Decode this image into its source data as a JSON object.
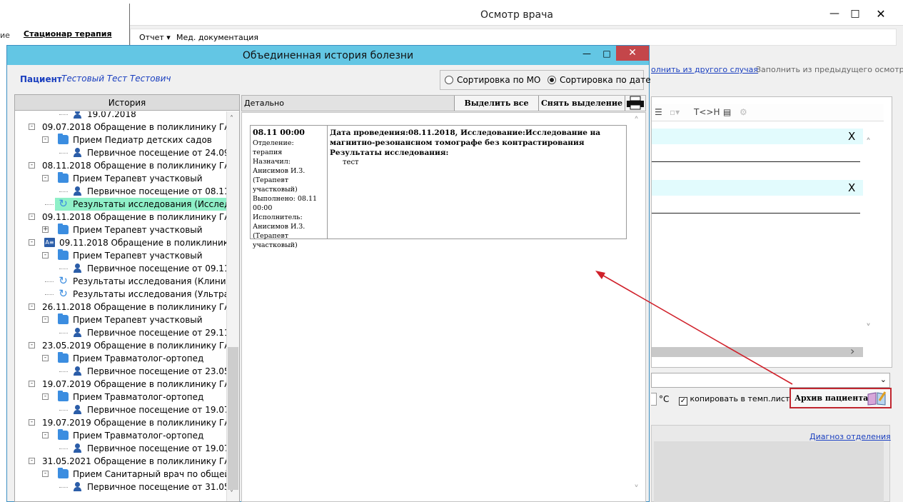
{
  "background": {
    "tab_label": "Стационар терапия",
    "left_fragment": "ие"
  },
  "exam_window": {
    "title": "Осмотр врача",
    "menu": [
      "Отчет",
      "Мед. документация"
    ],
    "links": {
      "fill_other_case": "олнить из другого случая",
      "fill_previous": "Заполнить из предыдущего осмотра",
      "diagnosis_dept": "Диагноз отделения"
    },
    "toolbar_tokens": "T<>H",
    "row_close_mark": "X",
    "temp_unit": "°C",
    "copy_to_temp_sheet_label": "копировать в темп.лист",
    "copy_to_temp_sheet_checked": true,
    "archive_button": "Архив пациента"
  },
  "history_window": {
    "title": "Объединенная история болезни",
    "patient_label": "Пациент",
    "patient_name": "Тестовый Тест Тестович",
    "sort_options": [
      {
        "label": "Сортировка по МО",
        "selected": false
      },
      {
        "label": "Сортировка по дате",
        "selected": true
      }
    ],
    "tree_header": "История",
    "tree_rows": [
      {
        "level": 3,
        "icon": "person-icon",
        "text": "19.07.2018"
      },
      {
        "level": 1,
        "icon": "",
        "text": "09.07.2018  Обращение в поликлинику ГАУЗ",
        "expander": "-"
      },
      {
        "level": 2,
        "icon": "folder-icon",
        "text": "Прием Педиатр детских садов",
        "expander": "-"
      },
      {
        "level": 3,
        "icon": "person-icon",
        "text": "Первичное посещение от 24.09.2"
      },
      {
        "level": 1,
        "icon": "",
        "text": "08.11.2018  Обращение в поликлинику ГАУЗ",
        "expander": "-"
      },
      {
        "level": 2,
        "icon": "folder-icon",
        "text": "Прием Терапевт участковый",
        "expander": "-"
      },
      {
        "level": 3,
        "icon": "person-icon",
        "text": "Первичное посещение от 08.11.2"
      },
      {
        "level": 2,
        "icon": "refresh-icon",
        "text": "Результаты исследования (Исследо",
        "selected": true
      },
      {
        "level": 1,
        "icon": "",
        "text": "09.11.2018  Обращение в поликлинику ГАУЗ",
        "expander": "-"
      },
      {
        "level": 2,
        "icon": "folder-icon",
        "text": "Прием Терапевт участковый",
        "expander": "+"
      },
      {
        "level": 1,
        "icon": "card-icon",
        "text": "09.11.2018  Обращение в поликлинику П",
        "expander": "-"
      },
      {
        "level": 2,
        "icon": "folder-icon",
        "text": "Прием Терапевт участковый",
        "expander": "-"
      },
      {
        "level": 3,
        "icon": "person-icon",
        "text": "Первичное посещение от 09.11.2"
      },
      {
        "level": 2,
        "icon": "refresh-icon",
        "text": "Результаты исследования (Клиниче"
      },
      {
        "level": 2,
        "icon": "refresh-icon",
        "text": "Результаты исследования (Ультраз"
      },
      {
        "level": 1,
        "icon": "",
        "text": "26.11.2018  Обращение в поликлинику ГАУЗ",
        "expander": "-"
      },
      {
        "level": 2,
        "icon": "folder-icon",
        "text": "Прием Терапевт участковый",
        "expander": "-"
      },
      {
        "level": 3,
        "icon": "person-icon",
        "text": "Первичное посещение от 29.11.2"
      },
      {
        "level": 1,
        "icon": "",
        "text": "23.05.2019  Обращение в поликлинику ГАУЗ",
        "expander": "-"
      },
      {
        "level": 2,
        "icon": "folder-icon",
        "text": "Прием Травматолог-ортопед",
        "expander": "-"
      },
      {
        "level": 3,
        "icon": "person-icon",
        "text": "Первичное посещение от 23.05.2"
      },
      {
        "level": 1,
        "icon": "",
        "text": "19.07.2019  Обращение в поликлинику ГАУЗ",
        "expander": "-"
      },
      {
        "level": 2,
        "icon": "folder-icon",
        "text": "Прием Травматолог-ортопед",
        "expander": "-"
      },
      {
        "level": 3,
        "icon": "person-icon",
        "text": "Первичное посещение от 19.07.2"
      },
      {
        "level": 1,
        "icon": "",
        "text": "19.07.2019  Обращение в поликлинику ГАУЗ",
        "expander": "-"
      },
      {
        "level": 2,
        "icon": "folder-icon",
        "text": "Прием Травматолог-ортопед",
        "expander": "-"
      },
      {
        "level": 3,
        "icon": "person-icon",
        "text": "Первичное посещение от 19.07.2"
      },
      {
        "level": 1,
        "icon": "",
        "text": "31.05.2021  Обращение в поликлинику ГАУЗ",
        "expander": "-"
      },
      {
        "level": 2,
        "icon": "folder-icon",
        "text": "Прием Санитарный врач по общей г",
        "expander": "-"
      },
      {
        "level": 3,
        "icon": "person-icon",
        "text": "Первичное посещение от 31.05.2"
      }
    ],
    "detail": {
      "header": "Детально",
      "select_all": "Выделить все",
      "deselect": "Снять выделение",
      "record": {
        "datetime": "08.11 00:00",
        "department": "Отделение: терапия",
        "assigned": "Назначил: Анисимов И.З. (Терапевт участковый)",
        "done": "Выполнено: 08.11 00:00",
        "executor": "Исполнитель: Анисимов И.З. (Терапевт участковый)",
        "summary": "Дата проведения:08.11.2018, Исследование:Исследование на магнитно-резонансном томографе без контрастирования",
        "results_label": "Результаты исследования:",
        "results_value": "тест"
      }
    }
  }
}
